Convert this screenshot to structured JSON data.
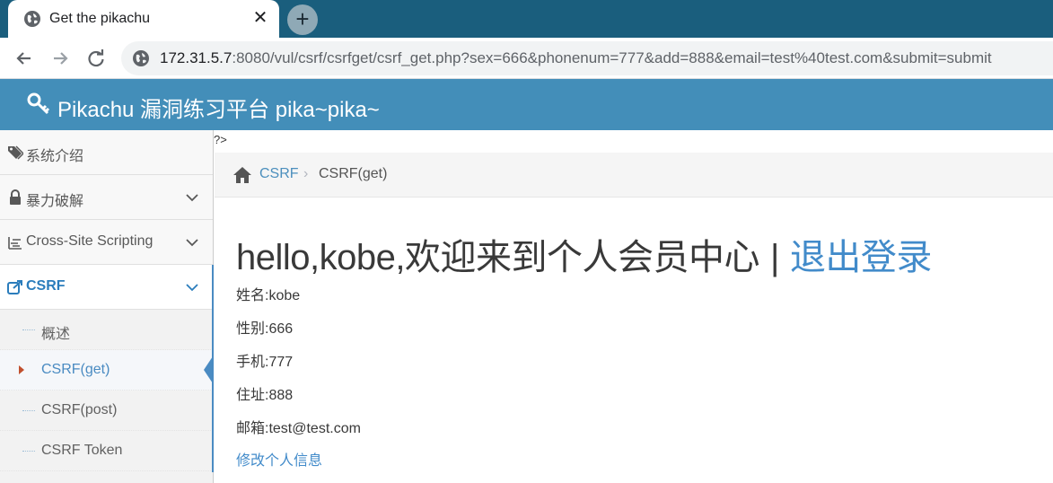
{
  "browser": {
    "tab_title": "Get the pikachu",
    "close_glyph": "✕",
    "new_tab_glyph": "+",
    "url_host": "172.31.5.7",
    "url_rest": ":8080/vul/csrf/csrfget/csrf_get.php?sex=666&phonenum=777&add=888&email=test%40test.com&submit=submit"
  },
  "header": {
    "title": "Pikachu 漏洞练习平台 pika~pika~",
    "bg_color": "#438eb9"
  },
  "sidebar": {
    "items": [
      {
        "label": "系统介绍",
        "icon": "tags-icon"
      },
      {
        "label": "暴力破解",
        "icon": "lock-icon"
      },
      {
        "label": "Cross-Site Scripting",
        "icon": "xss-icon"
      },
      {
        "label": "CSRF",
        "icon": "share-icon"
      }
    ],
    "submenu": [
      {
        "label": "概述"
      },
      {
        "label": "CSRF(get)"
      },
      {
        "label": "CSRF(post)"
      },
      {
        "label": "CSRF Token"
      }
    ]
  },
  "main": {
    "php_tag": "?>",
    "breadcrumb": {
      "link": "CSRF",
      "separator": "›",
      "current": "CSRF(get)"
    },
    "greeting": "hello,kobe,欢迎来到个人会员中心",
    "greeting_sep": "|",
    "logout": "退出登录",
    "info": [
      "姓名:kobe",
      "性别:666",
      "手机:777",
      "住址:888",
      "邮箱:test@test.com"
    ],
    "edit_link": "修改个人信息"
  },
  "colors": {
    "accent": "#428bca",
    "tabstrip": "#1a5e7d"
  }
}
